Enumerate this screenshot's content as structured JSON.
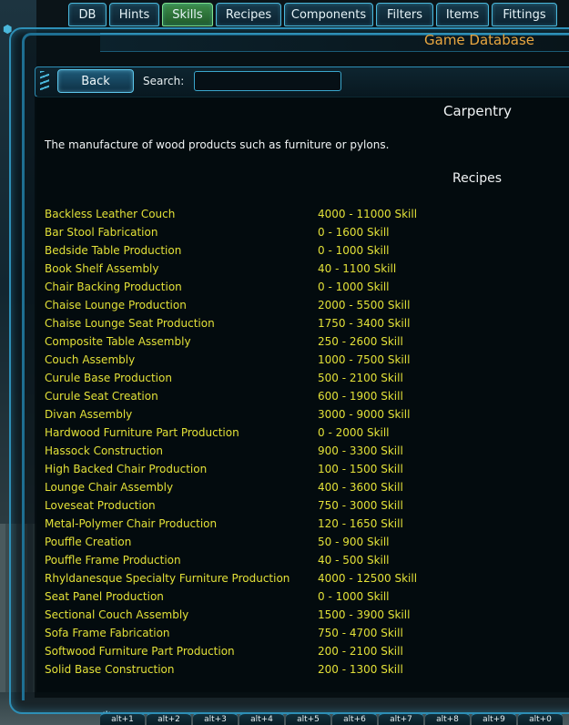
{
  "tabs": [
    {
      "label": "DB",
      "active": false
    },
    {
      "label": "Hints",
      "active": false
    },
    {
      "label": "Skills",
      "active": true
    },
    {
      "label": "Recipes",
      "active": false
    },
    {
      "label": "Components",
      "active": false
    },
    {
      "label": "Filters",
      "active": false
    },
    {
      "label": "Items",
      "active": false
    },
    {
      "label": "Fittings",
      "active": false
    }
  ],
  "header": {
    "title": "Game Database"
  },
  "toolbar": {
    "back_label": "Back",
    "search_label": "Search:",
    "search_value": ""
  },
  "skill": {
    "name": "Carpentry",
    "description": "The manufacture of wood products such as furniture or pylons.",
    "recipes_heading": "Recipes"
  },
  "recipes": [
    {
      "name": "Backless Leather Couch",
      "skill": "4000 - 11000 Skill"
    },
    {
      "name": "Bar Stool Fabrication",
      "skill": "0 - 1600 Skill"
    },
    {
      "name": "Bedside Table Production",
      "skill": "0 - 1000 Skill"
    },
    {
      "name": "Book Shelf Assembly",
      "skill": "40 - 1100 Skill"
    },
    {
      "name": "Chair Backing Production",
      "skill": "0 - 1000 Skill"
    },
    {
      "name": "Chaise Lounge Production",
      "skill": "2000 - 5500 Skill"
    },
    {
      "name": "Chaise Lounge Seat Production",
      "skill": "1750 - 3400 Skill"
    },
    {
      "name": "Composite Table Assembly",
      "skill": "250 - 2600 Skill"
    },
    {
      "name": "Couch Assembly",
      "skill": "1000 - 7500 Skill"
    },
    {
      "name": "Curule Base Production",
      "skill": "500 - 2100 Skill"
    },
    {
      "name": "Curule Seat Creation",
      "skill": "600 - 1900 Skill"
    },
    {
      "name": "Divan Assembly",
      "skill": "3000 - 9000 Skill"
    },
    {
      "name": "Hardwood Furniture Part Production",
      "skill": "0 - 2000 Skill"
    },
    {
      "name": "Hassock Construction",
      "skill": "900 - 3300 Skill"
    },
    {
      "name": "High Backed Chair Production",
      "skill": "100 - 1500 Skill"
    },
    {
      "name": "Lounge Chair Assembly",
      "skill": "400 - 3600 Skill"
    },
    {
      "name": "Loveseat Production",
      "skill": "750 - 3000 Skill"
    },
    {
      "name": "Metal-Polymer Chair Production",
      "skill": "120 - 1650 Skill"
    },
    {
      "name": "Pouffle Creation",
      "skill": "50 - 900 Skill"
    },
    {
      "name": "Pouffle Frame Production",
      "skill": "40 - 500 Skill"
    },
    {
      "name": "Rhyldanesque Specialty Furniture Production",
      "skill": "4000 - 12500 Skill"
    },
    {
      "name": "Seat Panel Production",
      "skill": "0 - 1000 Skill"
    },
    {
      "name": "Sectional Couch Assembly",
      "skill": "1500 - 3900 Skill"
    },
    {
      "name": "Sofa Frame Fabrication",
      "skill": "750 - 4700 Skill"
    },
    {
      "name": "Softwood Furniture Part Production",
      "skill": "200 - 2100 Skill"
    },
    {
      "name": "Solid Base Construction",
      "skill": "200 - 1300 Skill"
    }
  ],
  "hotkeys": [
    "alt+1",
    "alt+2",
    "alt+3",
    "alt+4",
    "alt+5",
    "alt+6",
    "alt+7",
    "alt+8",
    "alt+9",
    "alt+0"
  ],
  "colors": {
    "accent": "#2d8fb6",
    "title": "#e8a640",
    "recipe_text": "#e2e038",
    "active_tab": "#3d8d4a"
  }
}
